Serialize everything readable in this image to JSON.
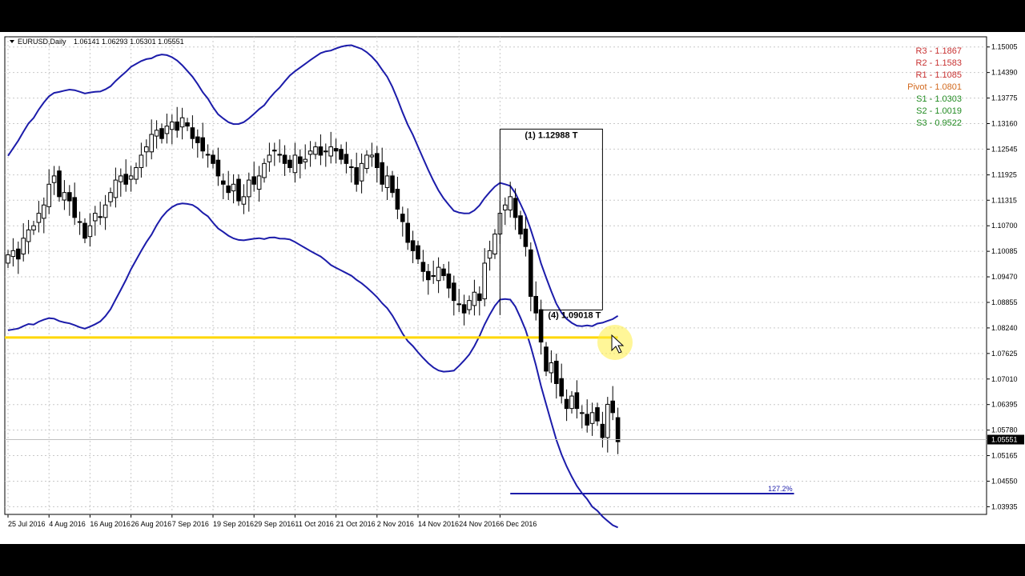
{
  "chart_data": {
    "type": "candlestick",
    "symbol_label": "EURUSD,Daily",
    "ohlc_label": "1.06141 1.06293 1.05301 1.05551",
    "current_price_label": "1.05551",
    "current_price": 1.05551,
    "ylim": [
      1.0375,
      1.1525
    ],
    "grid": true,
    "y_ticks": [
      "1.15005",
      "1.14390",
      "1.13775",
      "1.13160",
      "1.12545",
      "1.11925",
      "1.11315",
      "1.10700",
      "1.10085",
      "1.09470",
      "1.08855",
      "1.08240",
      "1.07625",
      "1.07010",
      "1.06395",
      "1.05780",
      "1.05165",
      "1.04550",
      "1.03935"
    ],
    "x_ticks": [
      {
        "label": "25 Jul 2016",
        "index": 0
      },
      {
        "label": "4 Aug 2016",
        "index": 8
      },
      {
        "label": "16 Aug 2016",
        "index": 16
      },
      {
        "label": "26 Aug 2016",
        "index": 24
      },
      {
        "label": "7 Sep 2016",
        "index": 32
      },
      {
        "label": "19 Sep 2016",
        "index": 40
      },
      {
        "label": "29 Sep 2016",
        "index": 48
      },
      {
        "label": "11 Oct 2016",
        "index": 56
      },
      {
        "label": "21 Oct 2016",
        "index": 64
      },
      {
        "label": "2 Nov 2016",
        "index": 72
      },
      {
        "label": "14 Nov 2016",
        "index": 80
      },
      {
        "label": "24 Nov 2016",
        "index": 88
      },
      {
        "label": "6 Dec 2016",
        "index": 96
      }
    ],
    "bar_count": 120,
    "closes": [
      1.1,
      1.101,
      1.099,
      1.104,
      1.106,
      1.107,
      1.11,
      1.112,
      1.117,
      1.119,
      1.114,
      1.115,
      1.113,
      1.109,
      1.108,
      1.104,
      1.107,
      1.11,
      1.109,
      1.112,
      1.115,
      1.118,
      1.119,
      1.117,
      1.119,
      1.121,
      1.124,
      1.126,
      1.129,
      1.13,
      1.128,
      1.131,
      1.132,
      1.13,
      1.133,
      1.131,
      1.128,
      1.127,
      1.125,
      1.124,
      1.122,
      1.119,
      1.117,
      1.115,
      1.117,
      1.113,
      1.114,
      1.118,
      1.117,
      1.119,
      1.122,
      1.124,
      1.125,
      1.124,
      1.122,
      1.121,
      1.124,
      1.122,
      1.123,
      1.125,
      1.126,
      1.124,
      1.125,
      1.126,
      1.125,
      1.123,
      1.122,
      1.121,
      1.117,
      1.122,
      1.124,
      1.124,
      1.121,
      1.117,
      1.119,
      1.115,
      1.111,
      1.108,
      1.103,
      1.101,
      1.099,
      1.096,
      1.094,
      1.095,
      1.097,
      1.095,
      1.092,
      1.089,
      1.088,
      1.086,
      1.089,
      1.091,
      1.089,
      1.098,
      1.101,
      1.105,
      1.11,
      1.112,
      1.114,
      1.109,
      1.105,
      1.102,
      1.09,
      1.086,
      1.079,
      1.072,
      1.074,
      1.069,
      1.066,
      1.063,
      1.066,
      1.063,
      1.062,
      1.059,
      1.062,
      1.06,
      1.056,
      1.064,
      1.062,
      1.055
    ],
    "pivot_levels": [
      {
        "label": "R3 - 1.1867",
        "color": "#c83232"
      },
      {
        "label": "R2 - 1.1583",
        "color": "#c83232"
      },
      {
        "label": "R1 - 1.1085",
        "color": "#c83232"
      },
      {
        "label": "Pivot - 1.0801",
        "color": "#d2691e"
      },
      {
        "label": "S1 - 1.0303",
        "color": "#228b22"
      },
      {
        "label": "S2 - 1.0019",
        "color": "#228b22"
      },
      {
        "label": "S3 - 0.9522",
        "color": "#228b22"
      }
    ],
    "annotations": [
      {
        "label": "(1)  1.12988  T",
        "value": 1.12988
      },
      {
        "label": "(4)  1.09018  T",
        "value": 1.09018
      },
      {
        "label": "127.2%",
        "value": 1.0425
      }
    ],
    "horizontal_line": {
      "value": 1.0801,
      "color": "#ffd700"
    },
    "band_color": "#1c1caa"
  }
}
